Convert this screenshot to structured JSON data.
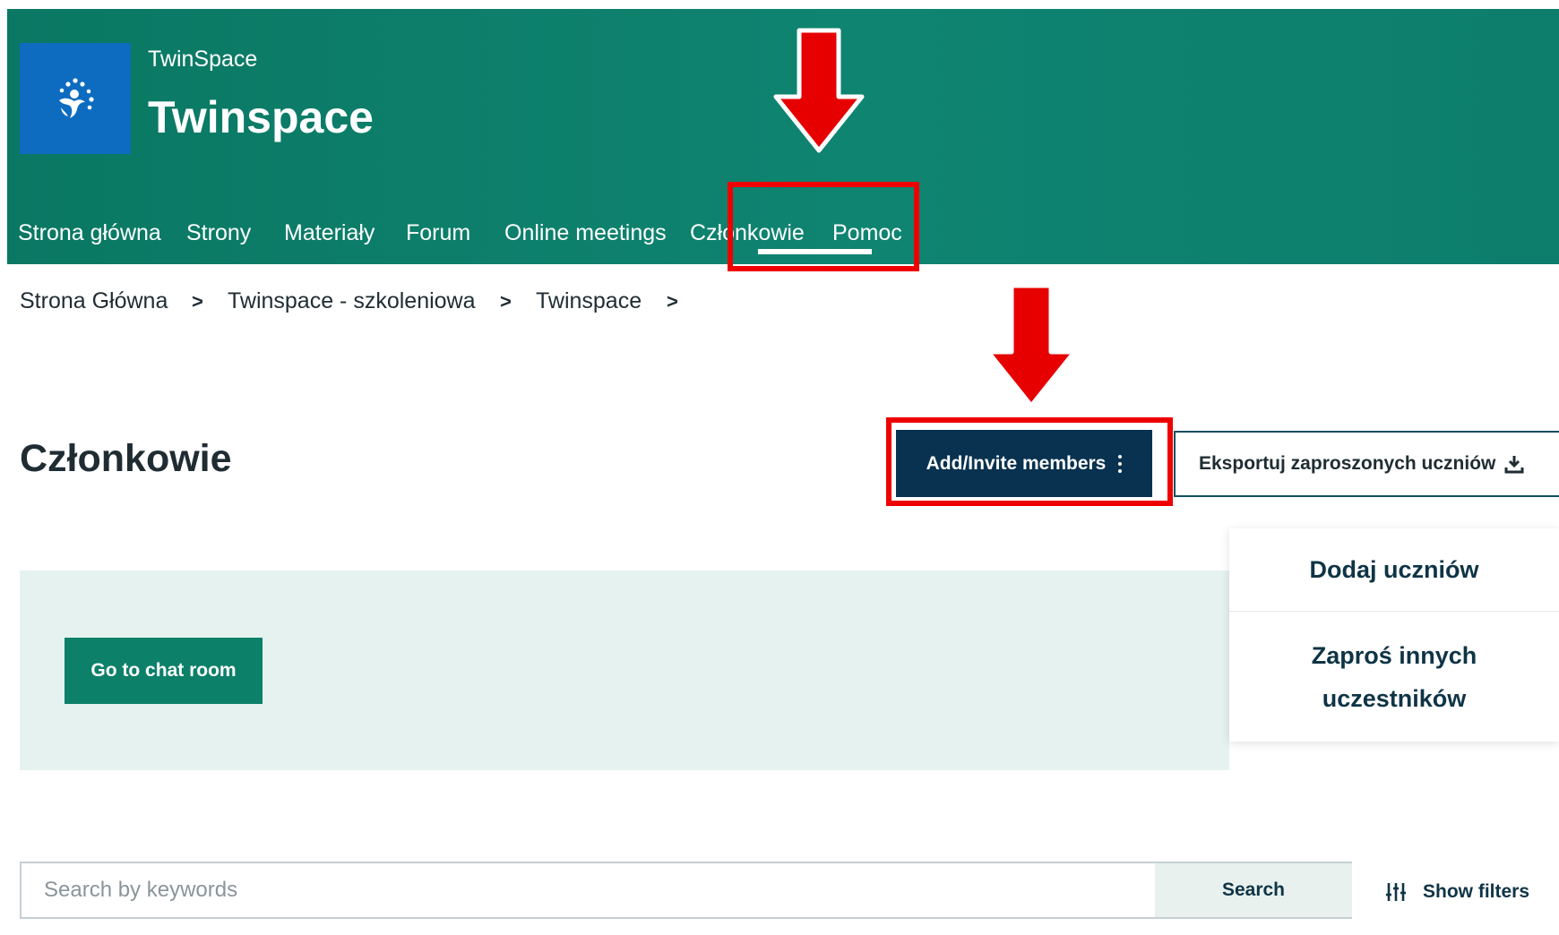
{
  "header": {
    "app_subtitle": "TwinSpace",
    "app_title": "Twinspace",
    "logo_icon": "stars-person-logo",
    "background_color": "#0d7e6c",
    "logo_color": "#0d6cbf"
  },
  "nav": {
    "items": [
      {
        "label": "Strona główna"
      },
      {
        "label": "Strony"
      },
      {
        "label": "Materiały"
      },
      {
        "label": "Forum"
      },
      {
        "label": "Online meetings"
      },
      {
        "label": "Członkowie",
        "active": true
      },
      {
        "label": "Pomoc"
      }
    ]
  },
  "breadcrumb": {
    "items": [
      "Strona Główna",
      "Twinspace - szkoleniowa",
      "Twinspace"
    ],
    "separator": ">"
  },
  "page": {
    "title": "Członkowie"
  },
  "actions": {
    "add_invite_label": "Add/Invite members",
    "export_label": "Eksportuj zaproszonych uczniów",
    "primary_color": "#08324f"
  },
  "dropdown": {
    "items": [
      {
        "label": "Dodaj uczniów"
      },
      {
        "label_lines": [
          "Zaproś innych",
          "uczestników"
        ]
      }
    ]
  },
  "chat": {
    "button_label": "Go to chat room",
    "button_color": "#0d8069",
    "panel_color": "#e6f2ef"
  },
  "search": {
    "placeholder": "Search by keywords",
    "value": "",
    "button_label": "Search",
    "filters_label": "Show filters"
  },
  "annotations": {
    "highlight_color": "#ee0000"
  }
}
